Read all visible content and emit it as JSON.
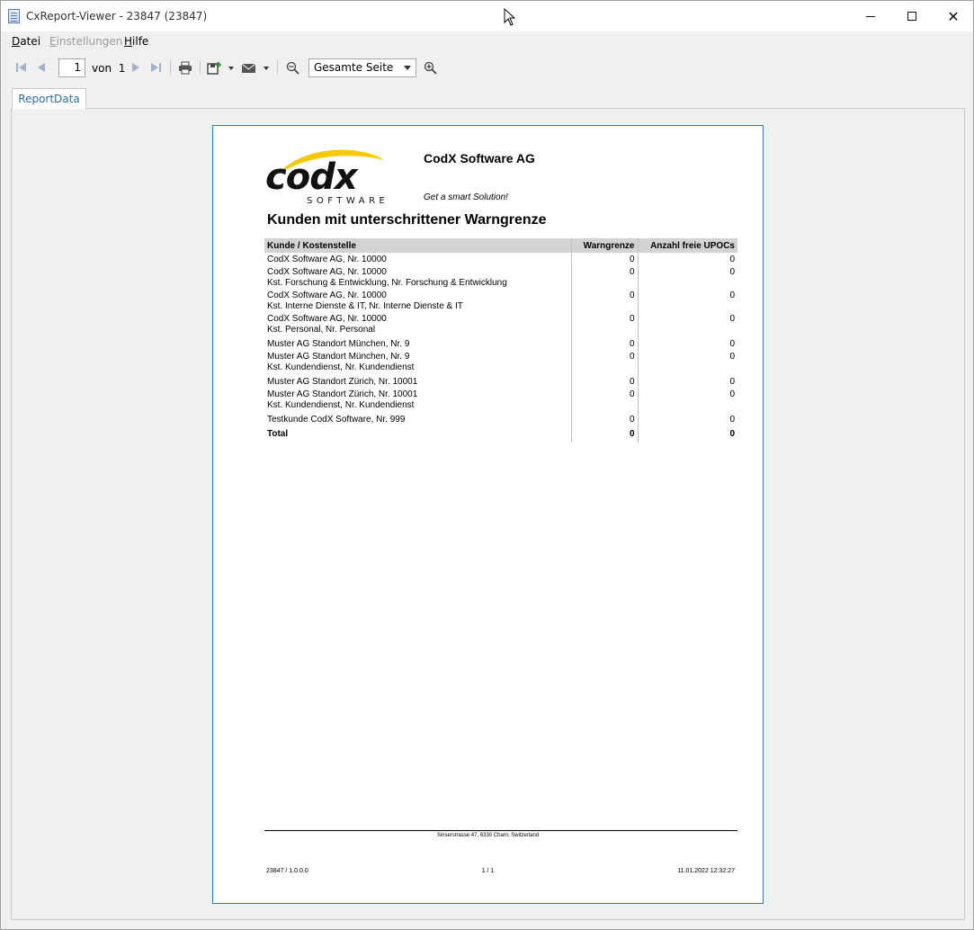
{
  "window": {
    "title": "CxReport-Viewer - 23847 (23847)",
    "minimize_glyph": "",
    "close_glyph": "✕"
  },
  "menu": {
    "datei": "Datei",
    "einstellungen": "Einstellungen",
    "hilfe": "Hilfe"
  },
  "toolbar": {
    "current_page": "1",
    "of_label": "von",
    "total_pages": "1",
    "zoom_value": "Gesamte Seite"
  },
  "tabs": [
    {
      "label": "ReportData"
    }
  ],
  "report": {
    "logo_text": "codx",
    "logo_sub": "SOFTWARE",
    "company": "CodX Software AG",
    "tagline": "Get a smart Solution!",
    "title": "Kunden mit unterschrittener Warngrenze",
    "columns": [
      "Kunde / Kostenstelle",
      "Warngrenze",
      "Anzahl freie UPOCs"
    ],
    "rows": [
      {
        "line1": "CodX Software AG, Nr. 10000",
        "line2": "",
        "warn": "0",
        "upocs": "0"
      },
      {
        "line1": "CodX Software AG, Nr. 10000",
        "line2": "Kst. Forschung & Entwicklung, Nr. Forschung & Entwicklung",
        "warn": "0",
        "upocs": "0"
      },
      {
        "line1": "CodX Software AG, Nr. 10000",
        "line2": "Kst. Interne Dienste & IT, Nr. Interne Dienste & IT",
        "warn": "0",
        "upocs": "0"
      },
      {
        "line1": "CodX Software AG, Nr. 10000",
        "line2": "Kst. Personal, Nr. Personal",
        "warn": "0",
        "upocs": "0"
      },
      {
        "line1": "Muster AG Standort München, Nr. 9",
        "line2": "",
        "warn": "0",
        "upocs": "0"
      },
      {
        "line1": "Muster AG Standort München, Nr. 9",
        "line2": "Kst. Kundendienst, Nr. Kundendienst",
        "warn": "0",
        "upocs": "0"
      },
      {
        "line1": "Muster AG Standort Zürich, Nr. 10001",
        "line2": "",
        "warn": "0",
        "upocs": "0"
      },
      {
        "line1": "Muster AG Standort Zürich, Nr. 10001",
        "line2": "Kst. Kundendienst, Nr. Kundendienst",
        "warn": "0",
        "upocs": "0"
      },
      {
        "line1": "Testkunde CodX Software, Nr. 999",
        "line2": "",
        "warn": "0",
        "upocs": "0"
      }
    ],
    "total": {
      "label": "Total",
      "warn": "0",
      "upocs": "0"
    },
    "address": "Sinserstrasse 47, 6330 Cham, Switzerland",
    "footer_left": "23847 / 1.0.0.0",
    "footer_mid": "1 / 1",
    "footer_right": "11.01.2022 12:32:27"
  },
  "colors": {
    "accent": "#2f7fc4",
    "logo_yellow": "#f5c800",
    "header_gray": "#d3d3d3"
  }
}
